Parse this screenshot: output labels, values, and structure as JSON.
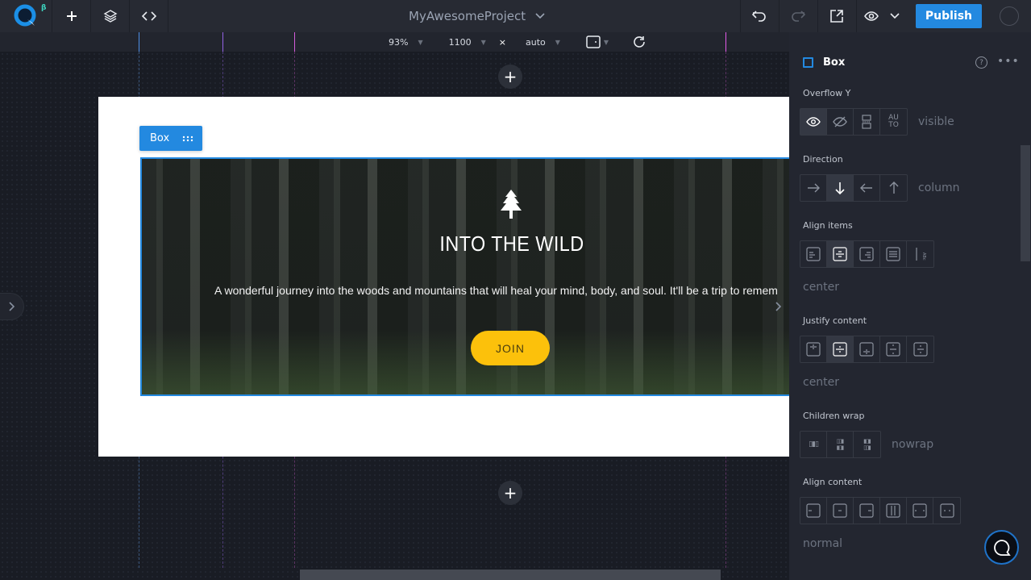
{
  "app": {
    "logo": "Q",
    "beta_badge": "β",
    "project_name": "MyAwesomeProject",
    "publish_label": "Publish",
    "colors": {
      "accent": "#2389e0",
      "join_button": "#fcc10b",
      "beta": "#3dd5c0"
    }
  },
  "toolbar": {
    "left_icons": [
      "add-icon",
      "layers-icon",
      "code-icon"
    ],
    "right_icons": [
      "undo-icon",
      "redo-icon",
      "open-external-icon",
      "preview-eye-icon",
      "chevron-down-icon"
    ]
  },
  "viewport": {
    "zoom": "93%",
    "width": "1100",
    "times": "×",
    "height": "auto",
    "device_icon": "device-frame-icon",
    "refresh_icon": "refresh-icon"
  },
  "canvas": {
    "selected_tag": "Box",
    "hero": {
      "icon": "pine-tree-icon",
      "heading": "INTO THE WILD",
      "description": "A wonderful journey into the woods and mountains that will heal your mind, body, and soul. It'll be a trip to remem",
      "button_label": "JOIN"
    }
  },
  "panel": {
    "element_name": "Box",
    "sections": [
      {
        "label": "Overflow Y",
        "options": [
          "visible",
          "hidden",
          "scroll",
          "auto"
        ],
        "selected_index": 0,
        "value": "visible"
      },
      {
        "label": "Direction",
        "options": [
          "row",
          "column",
          "row-reverse",
          "column-reverse"
        ],
        "selected_index": 1,
        "value": "column"
      },
      {
        "label": "Align items",
        "options": [
          "flex-start",
          "center",
          "flex-end",
          "stretch",
          "baseline"
        ],
        "selected_index": 1,
        "value": "center"
      },
      {
        "label": "Justify content",
        "options": [
          "flex-start",
          "center",
          "flex-end",
          "space-between",
          "space-around"
        ],
        "selected_index": 1,
        "value": "center"
      },
      {
        "label": "Children wrap",
        "options": [
          "nowrap",
          "wrap",
          "wrap-reverse"
        ],
        "selected_index": -1,
        "value": "nowrap"
      },
      {
        "label": "Align content",
        "options": [
          "flex-start",
          "center",
          "flex-end",
          "stretch",
          "space-between",
          "space-around"
        ],
        "selected_index": -1,
        "value": "normal"
      }
    ]
  }
}
